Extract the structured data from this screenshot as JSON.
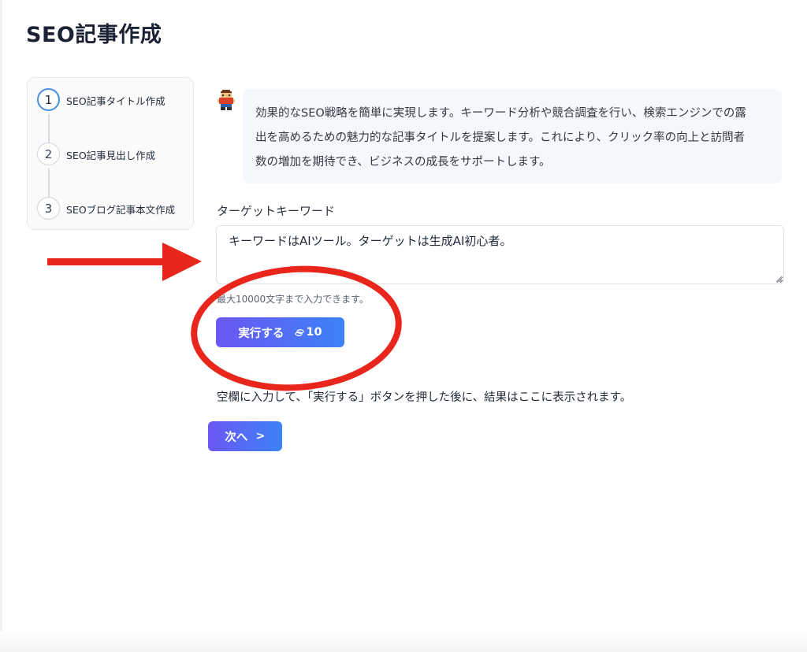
{
  "page": {
    "title": "SEO記事作成"
  },
  "stepper": {
    "steps": [
      {
        "number": "1",
        "label": "SEO記事タイトル作成",
        "active": true
      },
      {
        "number": "2",
        "label": "SEO記事見出し作成",
        "active": false
      },
      {
        "number": "3",
        "label": "SEOブログ記事本文作成",
        "active": false
      }
    ]
  },
  "intro": {
    "lines": [
      "効果的なSEO戦略を簡単に実現します。キーワード分析や競合調査を行い、検索エンジンでの露",
      "出を高めるための魅力的な記事タイトルを提案します。これにより、クリック率の向上と訪問者",
      "数の増加を期待でき、ビジネスの成長をサポートします。"
    ]
  },
  "form": {
    "label": "ターゲットキーワード",
    "value": "キーワードはAIツール。ターゲットは生成AI初心者。",
    "hint": "最大10000文字まで入力できます。",
    "run_label": "実行する",
    "credit_cost": "10"
  },
  "result": {
    "placeholder": "空欄に入力して、「実行する」ボタンを押した後に、結果はここに表示されます。"
  },
  "navigation": {
    "next_label": "次へ",
    "next_chevron": ">"
  },
  "colors": {
    "button_gradient_start": "#6b57f5",
    "button_gradient_end": "#3b82f6",
    "active_step": "#4a90d9",
    "annotation_red": "#e8261c"
  }
}
